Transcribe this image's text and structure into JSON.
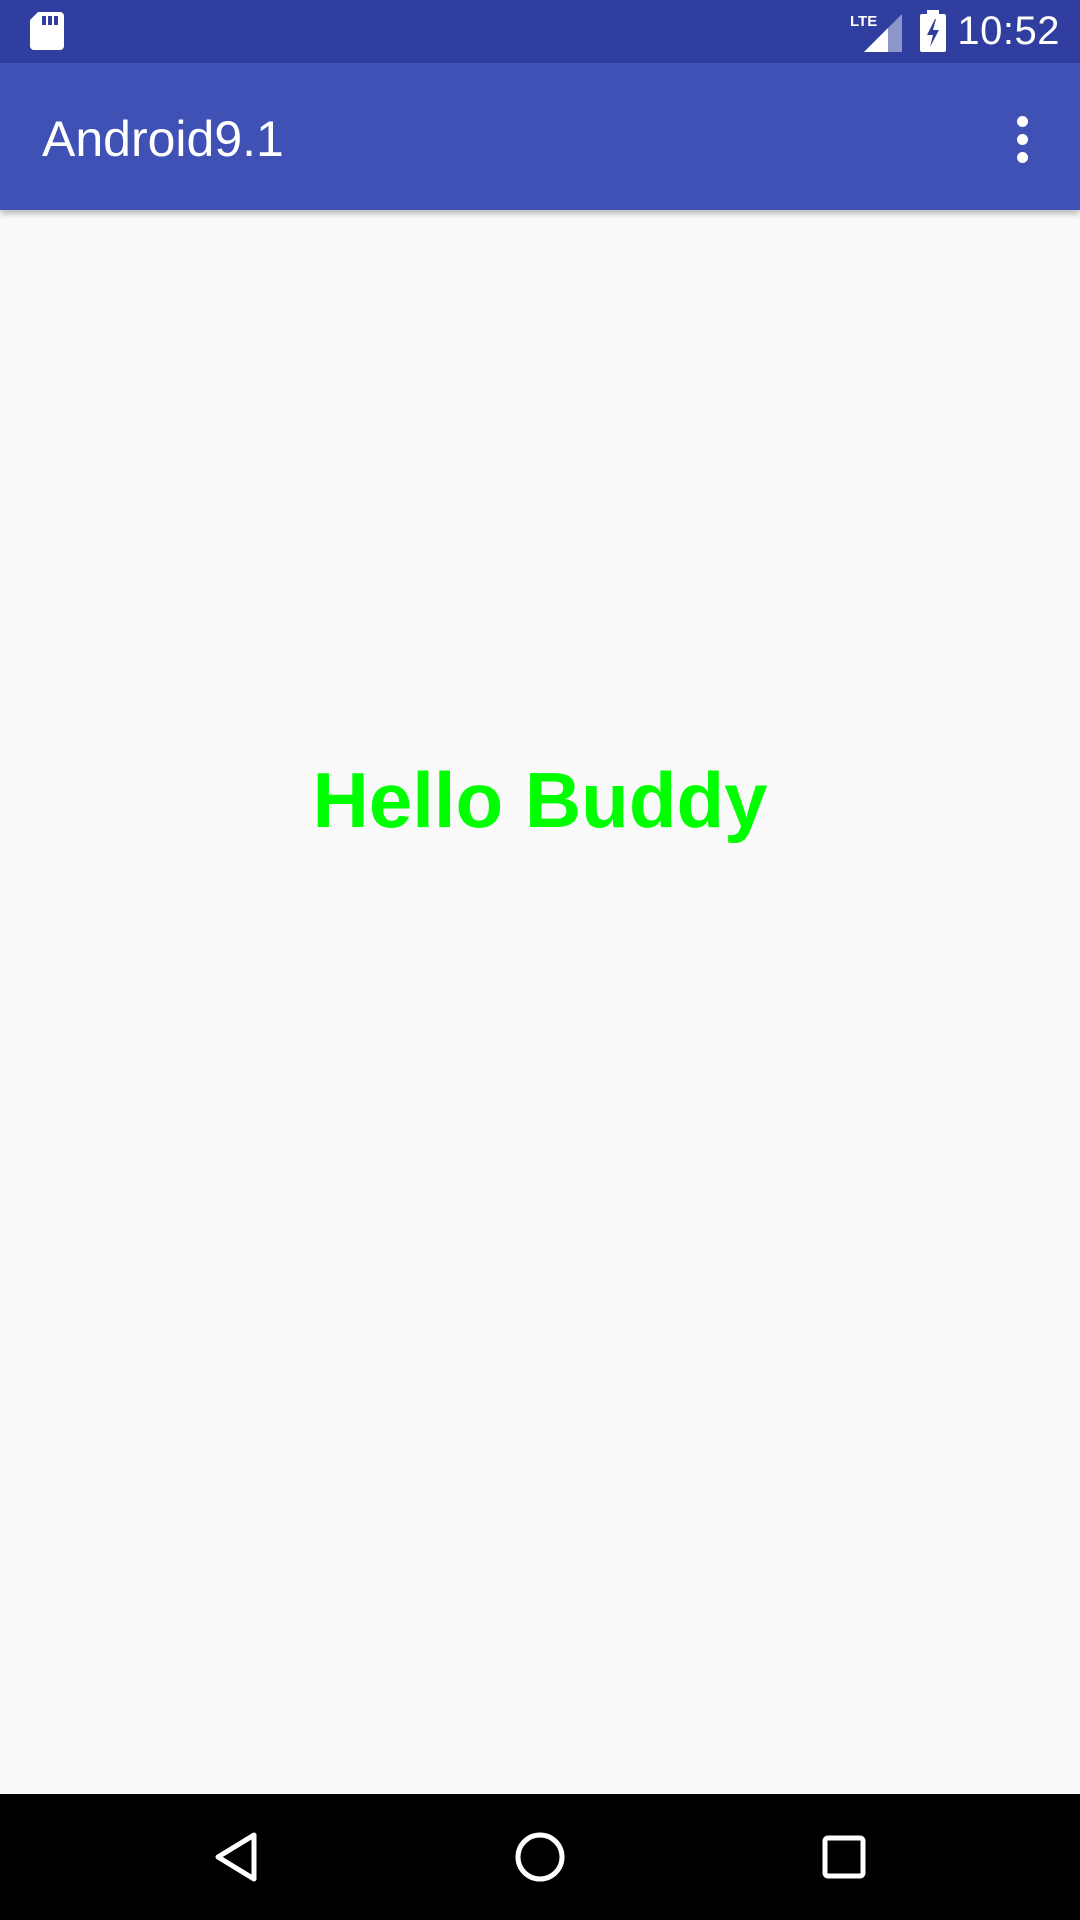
{
  "status_bar": {
    "time": "10:52",
    "network_label": "LTE",
    "icons": [
      "sd-card-icon",
      "lte-signal-icon",
      "battery-charging-icon"
    ]
  },
  "app_bar": {
    "title": "Android9.1",
    "overflow_icon": "more-vert-icon"
  },
  "content": {
    "message": "Hello Buddy"
  },
  "nav_bar": {
    "buttons": [
      "back-icon",
      "home-icon",
      "recents-icon"
    ]
  },
  "colors": {
    "status_bar": "#303F9F",
    "app_bar": "#3F51B5",
    "background": "#FAFAFA",
    "message_text": "#00FF00",
    "nav_bar": "#000000"
  }
}
